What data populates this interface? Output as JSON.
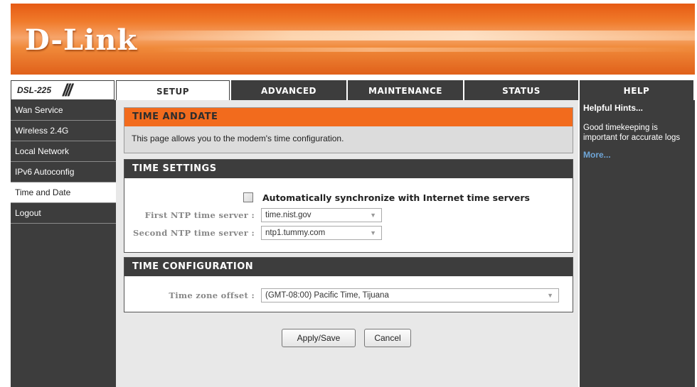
{
  "brand": {
    "logo_text": "D-Link"
  },
  "model": {
    "name": "DSL-225",
    "slashes": "///"
  },
  "tabs": [
    {
      "label": "SETUP",
      "active": true
    },
    {
      "label": "ADVANCED",
      "active": false
    },
    {
      "label": "MAINTENANCE",
      "active": false
    },
    {
      "label": "STATUS",
      "active": false
    },
    {
      "label": "HELP",
      "active": false
    }
  ],
  "sidebar": {
    "items": [
      {
        "label": "Wan Service",
        "active": false
      },
      {
        "label": "Wireless 2.4G",
        "active": false
      },
      {
        "label": "Local Network",
        "active": false
      },
      {
        "label": "IPv6 Autoconfig",
        "active": false
      },
      {
        "label": "Time and Date",
        "active": true
      },
      {
        "label": "Logout",
        "active": false
      }
    ]
  },
  "intro": {
    "title": "TIME AND DATE",
    "description": "This page allows you to the modem's time configuration."
  },
  "time_settings": {
    "title": "TIME SETTINGS",
    "auto_sync_label": "Automatically synchronize with Internet time servers",
    "auto_sync_checked": false,
    "first_ntp_label": "First NTP time server :",
    "first_ntp_value": "time.nist.gov",
    "second_ntp_label": "Second NTP time server :",
    "second_ntp_value": "ntp1.tummy.com"
  },
  "time_configuration": {
    "title": "TIME CONFIGURATION",
    "timezone_label": "Time zone offset :",
    "timezone_value": "(GMT-08:00) Pacific Time, Tijuana"
  },
  "buttons": {
    "apply_label": "Apply/Save",
    "cancel_label": "Cancel"
  },
  "help": {
    "title": "Helpful Hints...",
    "text": "Good timekeeping is important for accurate logs",
    "more_label": "More..."
  },
  "colors": {
    "accent_orange": "#f26b1d",
    "nav_dark": "#3d3d3d",
    "link_blue": "#6fa6d8"
  }
}
